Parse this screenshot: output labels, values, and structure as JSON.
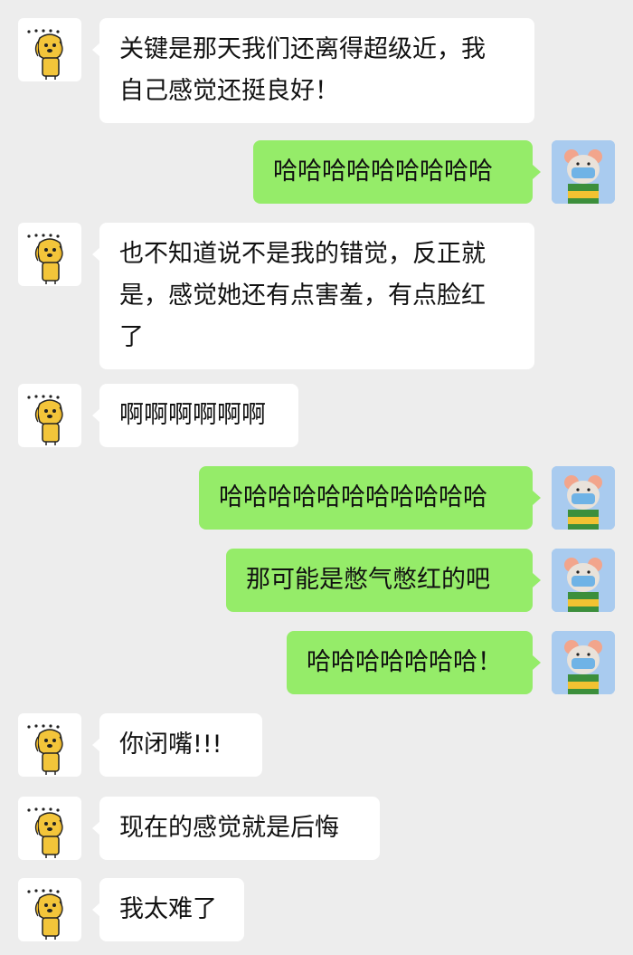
{
  "messages": [
    {
      "side": "in",
      "text": "关键是那天我们还离得超级近，我\n自己感觉还挺良好！",
      "avatar": "dog-avatar"
    },
    {
      "side": "out",
      "text": "哈哈哈哈哈哈哈哈哈",
      "avatar": "mouse-toy-avatar"
    },
    {
      "side": "in",
      "text": "也不知道说不是我的错觉，反正就\n是，感觉她还有点害羞，有点脸红\n了",
      "avatar": "dog-avatar"
    },
    {
      "side": "in",
      "text": "啊啊啊啊啊啊",
      "avatar": "dog-avatar"
    },
    {
      "side": "out",
      "text": "哈哈哈哈哈哈哈哈哈哈哈",
      "avatar": "mouse-toy-avatar"
    },
    {
      "side": "out",
      "text": "那可能是憋气憋红的吧",
      "avatar": "mouse-toy-avatar"
    },
    {
      "side": "out",
      "text": "哈哈哈哈哈哈哈！",
      "avatar": "mouse-toy-avatar"
    },
    {
      "side": "in",
      "text": "你闭嘴!!!",
      "avatar": "dog-avatar"
    },
    {
      "side": "in",
      "text": "现在的感觉就是后悔",
      "avatar": "dog-avatar"
    },
    {
      "side": "in",
      "text": "我太难了",
      "avatar": "dog-avatar"
    }
  ],
  "colors": {
    "background": "#ededed",
    "incoming": "#ffffff",
    "outgoing": "#95ec69"
  }
}
